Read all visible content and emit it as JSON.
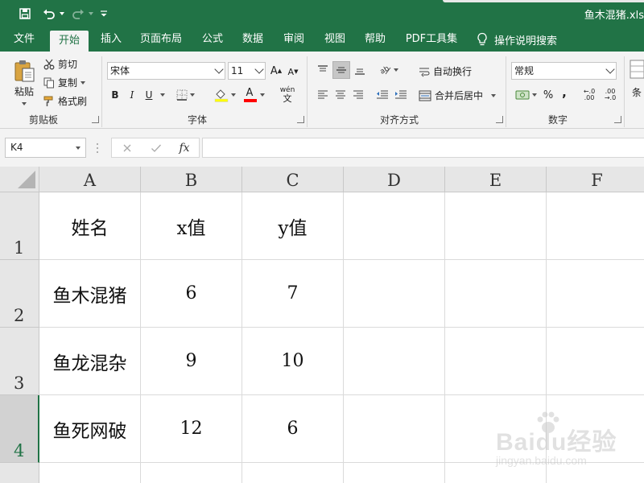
{
  "title_bar": {
    "filename": "鱼木混猪.xls"
  },
  "tabs": [
    {
      "label": "文件",
      "active": false
    },
    {
      "label": "开始",
      "active": true
    },
    {
      "label": "插入",
      "active": false
    },
    {
      "label": "页面布局",
      "active": false
    },
    {
      "label": "公式",
      "active": false
    },
    {
      "label": "数据",
      "active": false
    },
    {
      "label": "审阅",
      "active": false
    },
    {
      "label": "视图",
      "active": false
    },
    {
      "label": "帮助",
      "active": false
    },
    {
      "label": "PDF工具集",
      "active": false
    }
  ],
  "tell_me": "操作说明搜索",
  "ribbon": {
    "clipboard": {
      "label": "剪贴板",
      "paste": "粘贴",
      "cut": "剪切",
      "copy": "复制",
      "format_painter": "格式刷"
    },
    "font": {
      "label": "字体",
      "font_name": "宋体",
      "font_size": "11",
      "bold": "B",
      "italic": "I",
      "underline": "U",
      "wen": "wén",
      "wen_char": "文",
      "grow": "A",
      "shrink": "A",
      "font_color_letter": "A",
      "fill_color": "#ffff00",
      "font_color": "#ff0000"
    },
    "alignment": {
      "label": "对齐方式",
      "wrap_text": "自动换行",
      "merge_center": "合并后居中"
    },
    "number": {
      "label": "数字",
      "format": "常规",
      "percent": "%",
      "comma": ",",
      "inc_decimal": "←.0 .00",
      "dec_decimal": ".00 →.0"
    },
    "styles": {
      "partial": "条"
    }
  },
  "formula_bar": {
    "name_box": "K4",
    "fx": "fx",
    "formula": ""
  },
  "sheet": {
    "columns": [
      "A",
      "B",
      "C",
      "D",
      "E",
      "F"
    ],
    "rows": [
      "1",
      "2",
      "3",
      "4"
    ],
    "selected_row": "4",
    "cells": [
      [
        "姓名",
        "x值",
        "y值",
        "",
        "",
        ""
      ],
      [
        "鱼木混猪",
        "6",
        "7",
        "",
        "",
        ""
      ],
      [
        "鱼龙混杂",
        "9",
        "10",
        "",
        "",
        ""
      ],
      [
        "鱼死网破",
        "12",
        "6",
        "",
        "",
        ""
      ]
    ]
  },
  "watermark": {
    "main": "Baidu经验",
    "sub": "jingyan.baidu.com"
  },
  "colors": {
    "brand": "#217346",
    "ribbon_bg": "#f3f3f3",
    "header_bg": "#e6e6e6"
  }
}
